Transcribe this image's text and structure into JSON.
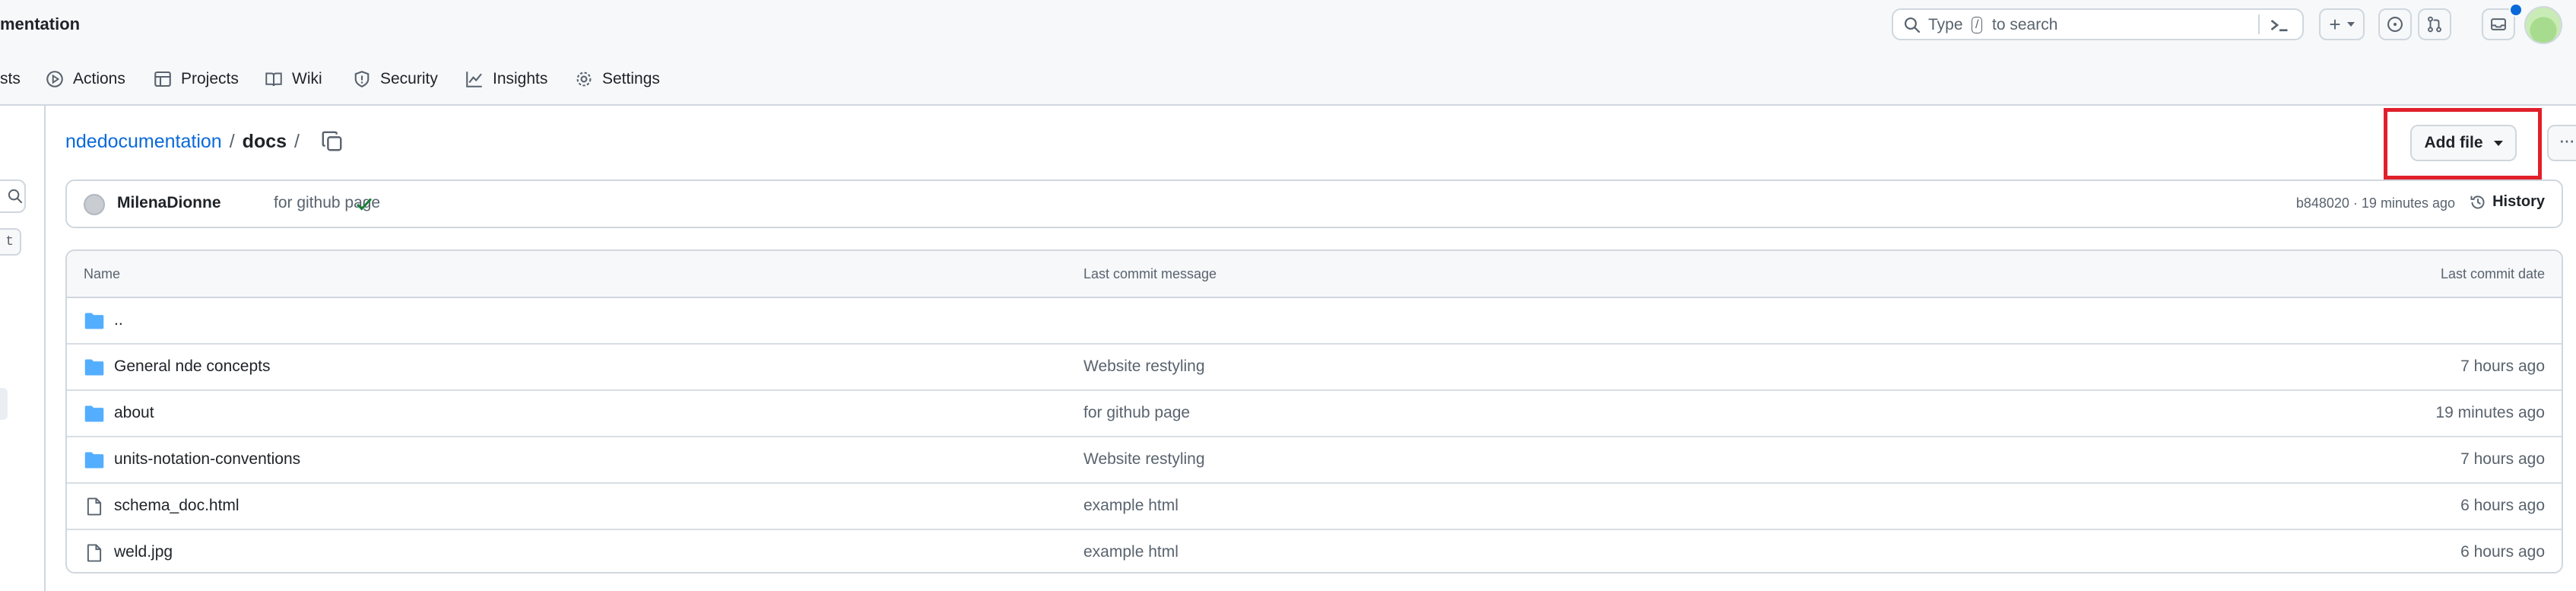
{
  "header": {
    "repo_title": "mentation",
    "search": {
      "type": "Type",
      "slash": "/",
      "rest": "to search"
    },
    "create_label": "+"
  },
  "nav": {
    "items": [
      {
        "label": "sts",
        "icon": "pull-request-icon"
      },
      {
        "label": "Actions",
        "icon": "play-icon"
      },
      {
        "label": "Projects",
        "icon": "table-icon"
      },
      {
        "label": "Wiki",
        "icon": "book-icon"
      },
      {
        "label": "Security",
        "icon": "shield-icon"
      },
      {
        "label": "Insights",
        "icon": "graph-icon"
      },
      {
        "label": "Settings",
        "icon": "gear-icon"
      }
    ]
  },
  "sidebar": {
    "shortcut_key": "t"
  },
  "breadcrumb": {
    "repo": "ndedocumentation",
    "sep1": "/",
    "current": "docs",
    "sep2": "/"
  },
  "toolbar": {
    "add_file": "Add file",
    "more": "···"
  },
  "commit": {
    "author": "MilenaDionne",
    "message": "for github page",
    "meta": "b848020 · 19 minutes ago",
    "history": "History"
  },
  "table": {
    "headers": {
      "name": "Name",
      "message": "Last commit message",
      "date": "Last commit date"
    },
    "rows": [
      {
        "type": "folder",
        "name": "..",
        "message": "",
        "date": ""
      },
      {
        "type": "folder",
        "name": "General nde concepts",
        "message": "Website restyling",
        "date": "7 hours ago"
      },
      {
        "type": "folder",
        "name": "about",
        "message": "for github page",
        "date": "19 minutes ago"
      },
      {
        "type": "folder",
        "name": "units-notation-conventions",
        "message": "Website restyling",
        "date": "7 hours ago"
      },
      {
        "type": "file",
        "name": "schema_doc.html",
        "message": "example html",
        "date": "6 hours ago"
      },
      {
        "type": "file",
        "name": "weld.jpg",
        "message": "example html",
        "date": "6 hours ago"
      }
    ]
  },
  "colors": {
    "link": "#0969da",
    "highlight": "#e0202b",
    "folder": "#54aeff",
    "check": "#1a7f37"
  }
}
